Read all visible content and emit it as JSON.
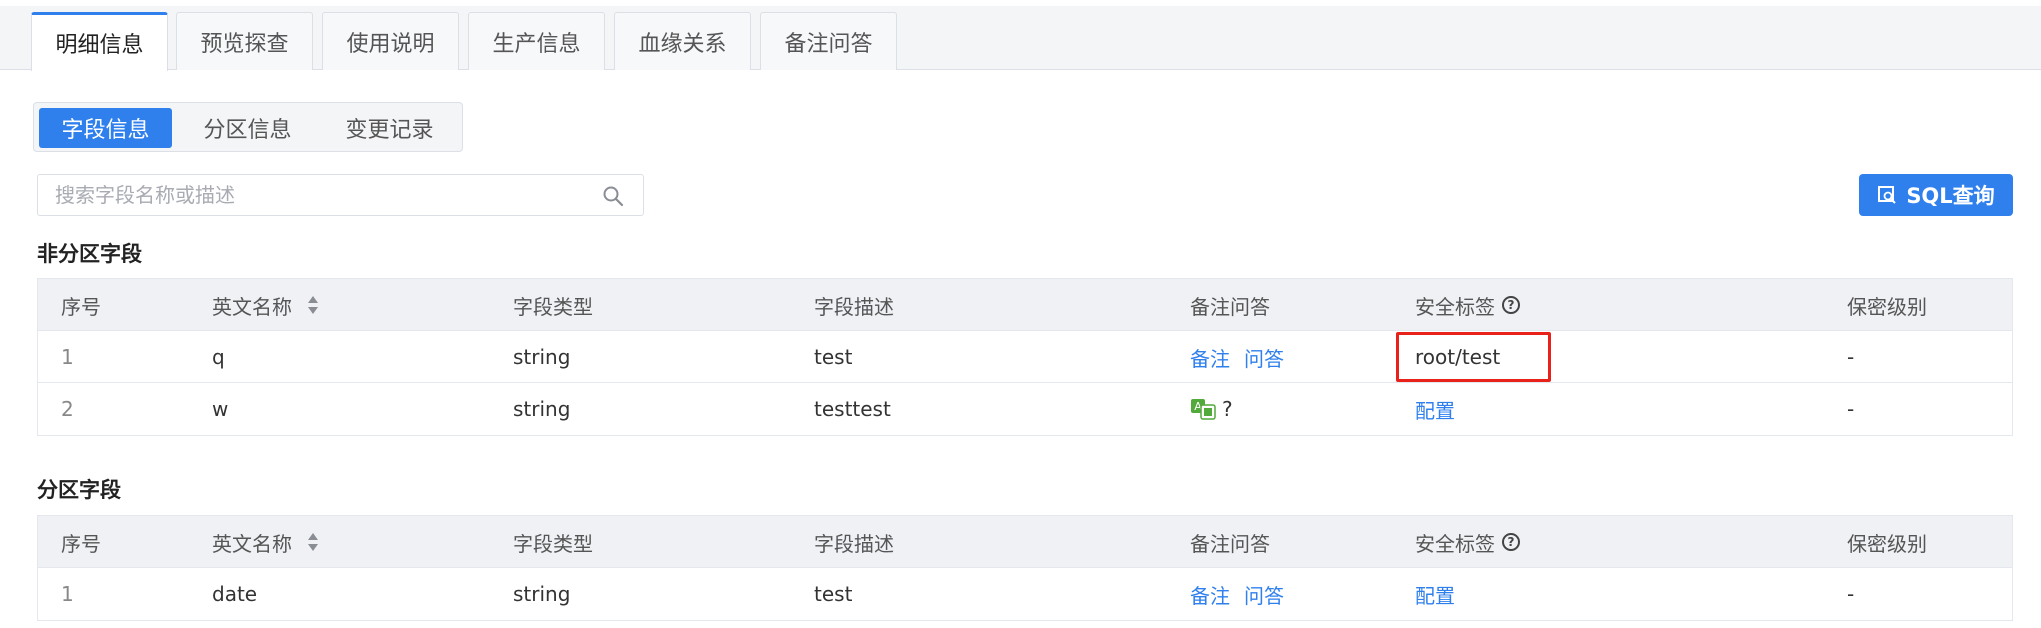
{
  "tabs": [
    "明细信息",
    "预览探查",
    "使用说明",
    "生产信息",
    "血缘关系",
    "备注问答"
  ],
  "subtabs": [
    "字段信息",
    "分区信息",
    "变更记录"
  ],
  "search": {
    "placeholder": "搜索字段名称或描述",
    "value": ""
  },
  "sql_button": {
    "label": "SQL查询"
  },
  "columns": [
    "序号",
    "英文名称",
    "字段类型",
    "字段描述",
    "备注问答",
    "安全标签",
    "保密级别"
  ],
  "non_partition": {
    "title": "非分区字段",
    "rows": [
      {
        "idx": "1",
        "name": "q",
        "type": "string",
        "desc": "test",
        "remark": "备注",
        "qa": "问答",
        "tag": "root/test",
        "level": "-"
      },
      {
        "idx": "2",
        "name": "w",
        "type": "string",
        "desc": "testtest",
        "qmark": "?",
        "config": "配置",
        "level": "-"
      }
    ]
  },
  "partition": {
    "title": "分区字段",
    "rows": [
      {
        "idx": "1",
        "name": "date",
        "type": "string",
        "desc": "test",
        "remark": "备注",
        "qa": "问答",
        "config": "配置",
        "level": "-"
      }
    ]
  },
  "colors": {
    "accent": "#2f80ed",
    "highlight": "#e8211b",
    "translate_icon": "#52a93c"
  },
  "icons": {
    "search": "search-icon",
    "sql": "sql-query-icon",
    "sort": "sort-icon",
    "help": "help-circle-icon",
    "translate": "translate-icon"
  }
}
